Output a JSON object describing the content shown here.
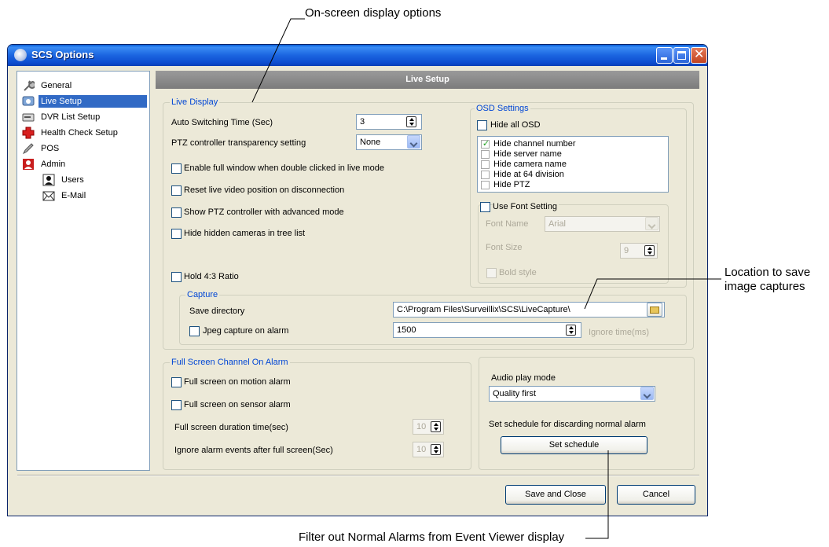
{
  "callouts": {
    "osd": "On-screen display options",
    "capture_line1": "Location to save",
    "capture_line2": "image captures",
    "schedule": "Filter out Normal Alarms from Event Viewer display"
  },
  "window": {
    "title": "SCS Options"
  },
  "sidebar": {
    "items": [
      {
        "label": "General",
        "icon": "wrench-icon"
      },
      {
        "label": "Live Setup",
        "icon": "live-setup-icon",
        "selected": true
      },
      {
        "label": "DVR List Setup",
        "icon": "dvr-icon"
      },
      {
        "label": "Health Check Setup",
        "icon": "health-cross-icon"
      },
      {
        "label": "POS",
        "icon": "pen-icon"
      },
      {
        "label": "Admin",
        "icon": "admin-user-icon"
      },
      {
        "label": "Users",
        "icon": "user-icon"
      },
      {
        "label": "E-Mail",
        "icon": "envelope-icon"
      }
    ]
  },
  "banner": "Live Setup",
  "live_display": {
    "title": "Live Display",
    "auto_switching_label": "Auto Switching Time (Sec)",
    "auto_switching_value": "3",
    "ptz_transparency_label": "PTZ controller transparency setting",
    "ptz_transparency_value": "None",
    "checkboxes": [
      "Enable full window when double clicked in live mode",
      "Reset live video position on disconnection",
      "Show PTZ controller with advanced mode",
      "Hide hidden cameras in tree list"
    ],
    "hold_ratio": "Hold 4:3 Ratio"
  },
  "osd": {
    "title": "OSD Settings",
    "hide_all": "Hide all OSD",
    "options": [
      {
        "label": "Hide channel number",
        "checked": true
      },
      {
        "label": "Hide server name",
        "checked": false
      },
      {
        "label": "Hide camera name",
        "checked": false
      },
      {
        "label": "Hide at 64 division",
        "checked": false
      },
      {
        "label": "Hide PTZ",
        "checked": false
      }
    ],
    "use_font": "Use Font Setting",
    "font_name_label": "Font Name",
    "font_name_value": "Arial",
    "font_size_label": "Font Size",
    "font_size_value": "9",
    "bold_style": "Bold style"
  },
  "capture": {
    "title": "Capture",
    "save_dir_label": "Save directory",
    "save_dir_value": "C:\\Program Files\\Surveillix\\SCS\\LiveCapture\\",
    "jpeg_label": "Jpeg capture on alarm",
    "ignore_value": "1500",
    "ignore_label": "Ignore time(ms)"
  },
  "fullscreen": {
    "title": "Full Screen Channel On Alarm",
    "motion": "Full screen on motion alarm",
    "sensor": "Full screen on sensor alarm",
    "duration_label": "Full screen duration time(sec)",
    "duration_value": "10",
    "ignore_label": "Ignore alarm events after full screen(Sec)",
    "ignore_value": "10"
  },
  "audio": {
    "label": "Audio play mode",
    "value": "Quality first",
    "schedule_label": "Set schedule for discarding normal alarm",
    "schedule_button": "Set schedule"
  },
  "footer": {
    "save": "Save and Close",
    "cancel": "Cancel"
  }
}
